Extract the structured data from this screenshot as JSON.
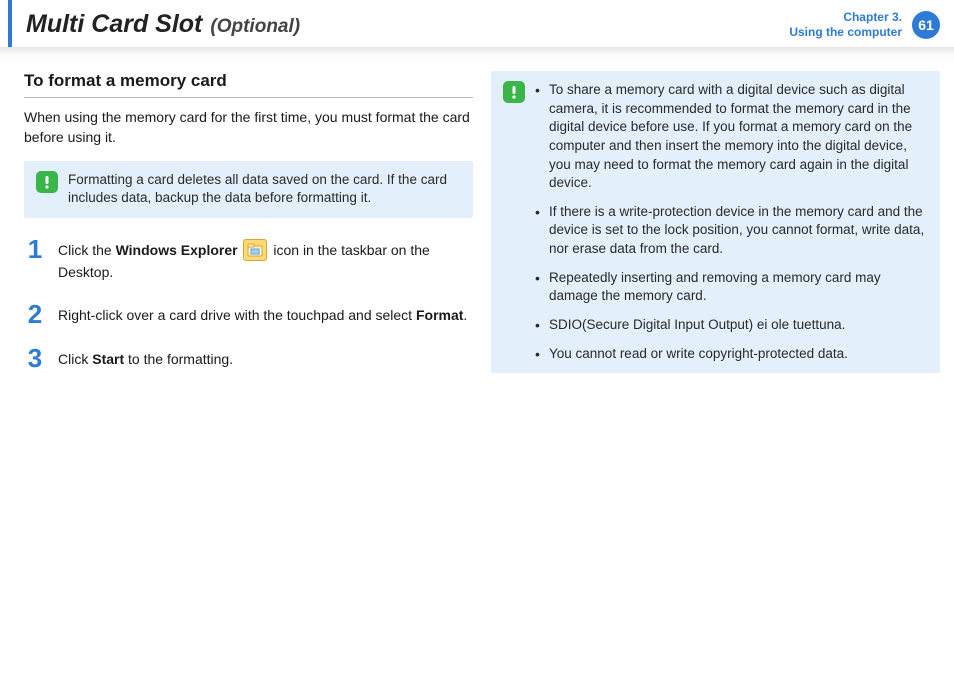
{
  "header": {
    "title_main": "Multi Card Slot",
    "title_sub": "(Optional)",
    "chapter_line1": "Chapter 3.",
    "chapter_line2": "Using the computer",
    "page_num": "61"
  },
  "left": {
    "section_title": "To format a memory card",
    "intro": "When using the memory card for the first time, you must format the card before using it.",
    "warning": "Formatting a card deletes all data saved on the card. If the card includes data, backup the data before formatting it.",
    "step1_a": "Click the ",
    "step1_b": "Windows Explorer",
    "step1_c": " icon in the taskbar on the Desktop.",
    "step2_a": "Right-click over a card drive with the touchpad and select ",
    "step2_b": "Format",
    "step2_c": ".",
    "step3_a": "Click ",
    "step3_b": "Start",
    "step3_c": " to the formatting."
  },
  "right": {
    "items": [
      "To share a memory card with a digital device such as digital camera, it is recommended to format the memory card in the digital device before use. If you format a memory card on the computer and then insert the memory into the digital device, you may need to format the memory card again in the digital device.",
      "If there is a write-protection device in the memory card and the device is set to the lock position, you cannot format, write data, nor erase data from the card.",
      "Repeatedly inserting and removing a memory card may damage the memory card.",
      "SDIO(Secure Digital Input Output) ei ole tuettuna.",
      "You cannot read or write copyright-protected data."
    ]
  }
}
